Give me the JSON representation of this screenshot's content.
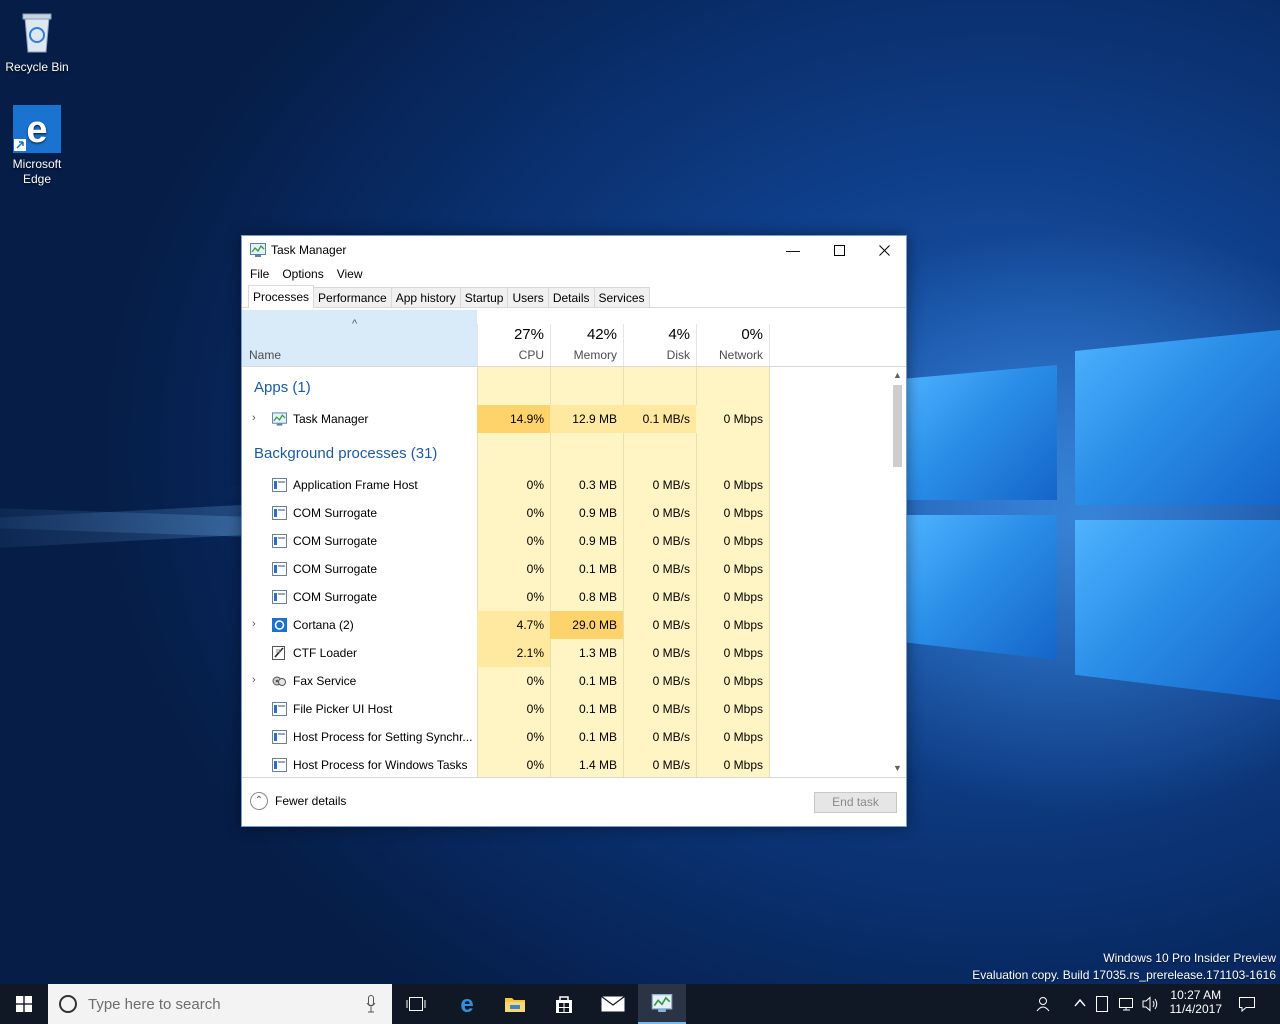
{
  "desktop": {
    "icons": [
      {
        "label": "Recycle Bin",
        "icon": "recycle-bin-icon"
      },
      {
        "label": "Microsoft Edge",
        "icon": "edge-icon"
      }
    ],
    "watermark_line1": "Windows 10 Pro Insider Preview",
    "watermark_line2": "Evaluation copy. Build 17035.rs_prerelease.171103-1616"
  },
  "window": {
    "title": "Task Manager",
    "minimize_glyph": "—",
    "maximize_glyph": "☐",
    "close_glyph": "✕"
  },
  "menu": [
    "File",
    "Options",
    "View"
  ],
  "tabs": [
    "Processes",
    "Performance",
    "App history",
    "Startup",
    "Users",
    "Details",
    "Services"
  ],
  "active_tab": "Processes",
  "columns": {
    "name": "Name",
    "sort_glyph": "^",
    "cpu": {
      "pct": "27%",
      "label": "CPU"
    },
    "memory": {
      "pct": "42%",
      "label": "Memory"
    },
    "disk": {
      "pct": "4%",
      "label": "Disk"
    },
    "network": {
      "pct": "0%",
      "label": "Network"
    }
  },
  "groups": {
    "apps": "Apps (1)",
    "background": "Background processes (31)"
  },
  "apps": [
    {
      "name": "Task Manager",
      "cpu": "14.9%",
      "mem": "12.9 MB",
      "disk": "0.1 MB/s",
      "net": "0 Mbps",
      "expandable": true,
      "icon": "task-manager-icon"
    }
  ],
  "processes": [
    {
      "name": "Application Frame Host",
      "cpu": "0%",
      "mem": "0.3 MB",
      "disk": "0 MB/s",
      "net": "0 Mbps",
      "expandable": false,
      "icon": "window-process-icon"
    },
    {
      "name": "COM Surrogate",
      "cpu": "0%",
      "mem": "0.9 MB",
      "disk": "0 MB/s",
      "net": "0 Mbps",
      "expandable": false,
      "icon": "window-process-icon"
    },
    {
      "name": "COM Surrogate",
      "cpu": "0%",
      "mem": "0.9 MB",
      "disk": "0 MB/s",
      "net": "0 Mbps",
      "expandable": false,
      "icon": "window-process-icon"
    },
    {
      "name": "COM Surrogate",
      "cpu": "0%",
      "mem": "0.1 MB",
      "disk": "0 MB/s",
      "net": "0 Mbps",
      "expandable": false,
      "icon": "window-process-icon"
    },
    {
      "name": "COM Surrogate",
      "cpu": "0%",
      "mem": "0.8 MB",
      "disk": "0 MB/s",
      "net": "0 Mbps",
      "expandable": false,
      "icon": "window-process-icon"
    },
    {
      "name": "Cortana (2)",
      "cpu": "4.7%",
      "mem": "29.0 MB",
      "disk": "0 MB/s",
      "net": "0 Mbps",
      "expandable": true,
      "icon": "cortana-icon"
    },
    {
      "name": "CTF Loader",
      "cpu": "2.1%",
      "mem": "1.3 MB",
      "disk": "0 MB/s",
      "net": "0 Mbps",
      "expandable": false,
      "icon": "ctf-loader-icon"
    },
    {
      "name": "Fax Service",
      "cpu": "0%",
      "mem": "0.1 MB",
      "disk": "0 MB/s",
      "net": "0 Mbps",
      "expandable": true,
      "icon": "fax-icon"
    },
    {
      "name": "File Picker UI Host",
      "cpu": "0%",
      "mem": "0.1 MB",
      "disk": "0 MB/s",
      "net": "0 Mbps",
      "expandable": false,
      "icon": "window-process-icon"
    },
    {
      "name": "Host Process for Setting Synchr...",
      "cpu": "0%",
      "mem": "0.1 MB",
      "disk": "0 MB/s",
      "net": "0 Mbps",
      "expandable": false,
      "icon": "window-process-icon"
    },
    {
      "name": "Host Process for Windows Tasks",
      "cpu": "0%",
      "mem": "1.4 MB",
      "disk": "0 MB/s",
      "net": "0 Mbps",
      "expandable": false,
      "icon": "window-process-icon"
    }
  ],
  "footer": {
    "fewer_details": "Fewer details",
    "end_task": "End task"
  },
  "taskbar": {
    "search_placeholder": "Type here to search",
    "time": "10:27 AM",
    "date": "11/4/2017",
    "pinned": [
      "task-view-icon",
      "edge-icon",
      "file-explorer-icon",
      "store-icon",
      "mail-icon",
      "task-manager-icon"
    ]
  },
  "colors": {
    "heat_low": "#fff4c4",
    "heat_mid": "#ffe8a0",
    "heat_high": "#ffd36b",
    "group_title": "#1e5aa0",
    "accent": "#76b9ed"
  }
}
